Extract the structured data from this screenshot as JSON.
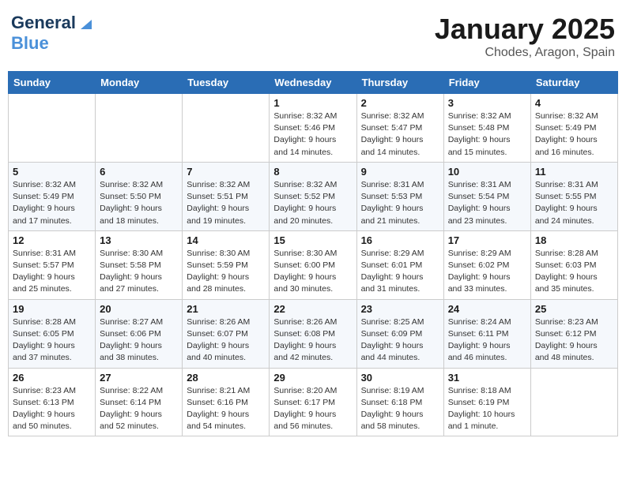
{
  "header": {
    "logo_line1": "General",
    "logo_line2": "Blue",
    "month": "January 2025",
    "location": "Chodes, Aragon, Spain"
  },
  "weekdays": [
    "Sunday",
    "Monday",
    "Tuesday",
    "Wednesday",
    "Thursday",
    "Friday",
    "Saturday"
  ],
  "weeks": [
    [
      {
        "day": "",
        "info": ""
      },
      {
        "day": "",
        "info": ""
      },
      {
        "day": "",
        "info": ""
      },
      {
        "day": "1",
        "info": "Sunrise: 8:32 AM\nSunset: 5:46 PM\nDaylight: 9 hours\nand 14 minutes."
      },
      {
        "day": "2",
        "info": "Sunrise: 8:32 AM\nSunset: 5:47 PM\nDaylight: 9 hours\nand 14 minutes."
      },
      {
        "day": "3",
        "info": "Sunrise: 8:32 AM\nSunset: 5:48 PM\nDaylight: 9 hours\nand 15 minutes."
      },
      {
        "day": "4",
        "info": "Sunrise: 8:32 AM\nSunset: 5:49 PM\nDaylight: 9 hours\nand 16 minutes."
      }
    ],
    [
      {
        "day": "5",
        "info": "Sunrise: 8:32 AM\nSunset: 5:49 PM\nDaylight: 9 hours\nand 17 minutes."
      },
      {
        "day": "6",
        "info": "Sunrise: 8:32 AM\nSunset: 5:50 PM\nDaylight: 9 hours\nand 18 minutes."
      },
      {
        "day": "7",
        "info": "Sunrise: 8:32 AM\nSunset: 5:51 PM\nDaylight: 9 hours\nand 19 minutes."
      },
      {
        "day": "8",
        "info": "Sunrise: 8:32 AM\nSunset: 5:52 PM\nDaylight: 9 hours\nand 20 minutes."
      },
      {
        "day": "9",
        "info": "Sunrise: 8:31 AM\nSunset: 5:53 PM\nDaylight: 9 hours\nand 21 minutes."
      },
      {
        "day": "10",
        "info": "Sunrise: 8:31 AM\nSunset: 5:54 PM\nDaylight: 9 hours\nand 23 minutes."
      },
      {
        "day": "11",
        "info": "Sunrise: 8:31 AM\nSunset: 5:55 PM\nDaylight: 9 hours\nand 24 minutes."
      }
    ],
    [
      {
        "day": "12",
        "info": "Sunrise: 8:31 AM\nSunset: 5:57 PM\nDaylight: 9 hours\nand 25 minutes."
      },
      {
        "day": "13",
        "info": "Sunrise: 8:30 AM\nSunset: 5:58 PM\nDaylight: 9 hours\nand 27 minutes."
      },
      {
        "day": "14",
        "info": "Sunrise: 8:30 AM\nSunset: 5:59 PM\nDaylight: 9 hours\nand 28 minutes."
      },
      {
        "day": "15",
        "info": "Sunrise: 8:30 AM\nSunset: 6:00 PM\nDaylight: 9 hours\nand 30 minutes."
      },
      {
        "day": "16",
        "info": "Sunrise: 8:29 AM\nSunset: 6:01 PM\nDaylight: 9 hours\nand 31 minutes."
      },
      {
        "day": "17",
        "info": "Sunrise: 8:29 AM\nSunset: 6:02 PM\nDaylight: 9 hours\nand 33 minutes."
      },
      {
        "day": "18",
        "info": "Sunrise: 8:28 AM\nSunset: 6:03 PM\nDaylight: 9 hours\nand 35 minutes."
      }
    ],
    [
      {
        "day": "19",
        "info": "Sunrise: 8:28 AM\nSunset: 6:05 PM\nDaylight: 9 hours\nand 37 minutes."
      },
      {
        "day": "20",
        "info": "Sunrise: 8:27 AM\nSunset: 6:06 PM\nDaylight: 9 hours\nand 38 minutes."
      },
      {
        "day": "21",
        "info": "Sunrise: 8:26 AM\nSunset: 6:07 PM\nDaylight: 9 hours\nand 40 minutes."
      },
      {
        "day": "22",
        "info": "Sunrise: 8:26 AM\nSunset: 6:08 PM\nDaylight: 9 hours\nand 42 minutes."
      },
      {
        "day": "23",
        "info": "Sunrise: 8:25 AM\nSunset: 6:09 PM\nDaylight: 9 hours\nand 44 minutes."
      },
      {
        "day": "24",
        "info": "Sunrise: 8:24 AM\nSunset: 6:11 PM\nDaylight: 9 hours\nand 46 minutes."
      },
      {
        "day": "25",
        "info": "Sunrise: 8:23 AM\nSunset: 6:12 PM\nDaylight: 9 hours\nand 48 minutes."
      }
    ],
    [
      {
        "day": "26",
        "info": "Sunrise: 8:23 AM\nSunset: 6:13 PM\nDaylight: 9 hours\nand 50 minutes."
      },
      {
        "day": "27",
        "info": "Sunrise: 8:22 AM\nSunset: 6:14 PM\nDaylight: 9 hours\nand 52 minutes."
      },
      {
        "day": "28",
        "info": "Sunrise: 8:21 AM\nSunset: 6:16 PM\nDaylight: 9 hours\nand 54 minutes."
      },
      {
        "day": "29",
        "info": "Sunrise: 8:20 AM\nSunset: 6:17 PM\nDaylight: 9 hours\nand 56 minutes."
      },
      {
        "day": "30",
        "info": "Sunrise: 8:19 AM\nSunset: 6:18 PM\nDaylight: 9 hours\nand 58 minutes."
      },
      {
        "day": "31",
        "info": "Sunrise: 8:18 AM\nSunset: 6:19 PM\nDaylight: 10 hours\nand 1 minute."
      },
      {
        "day": "",
        "info": ""
      }
    ]
  ]
}
